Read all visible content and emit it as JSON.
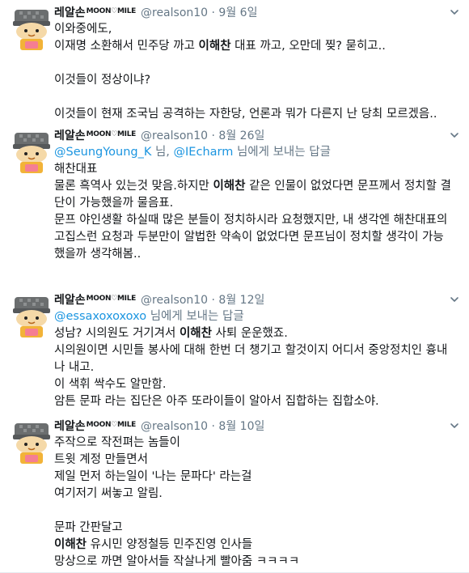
{
  "tweets": [
    {
      "name": "레알손",
      "name_sup": "MOON♡MILE",
      "handle_date": "@realson10 · 9월 6일",
      "reply": null,
      "lines": [
        {
          "parts": [
            "이와중에도,"
          ]
        },
        {
          "parts": [
            "이재명 소환해서 민주당 까고 ",
            "이해찬",
            " 대표 까고, 오만데 찢? 묻히고.."
          ],
          "bold": [
            1
          ]
        },
        {
          "parts": [
            ""
          ]
        },
        {
          "parts": [
            "이것들이 정상이냐?"
          ]
        },
        {
          "parts": [
            ""
          ]
        },
        {
          "parts": [
            "이것들이 현재 조국님 공격하는 자한당, 언론과 뭐가 다른지 난 당최 모르겠음.."
          ]
        }
      ]
    },
    {
      "name": "레알손",
      "name_sup": "MOON♡MILE",
      "handle_date": "@realson10 · 8월 26일",
      "reply": {
        "m1": "@SeungYoung_K",
        "sep": " 님, ",
        "m2": "@IEcharm",
        "suffix": " 님에게 보내는 답글"
      },
      "lines": [
        {
          "parts": [
            "해찬대표"
          ]
        },
        {
          "parts": [
            "물론 흑역사 있는것 맞음.하지만 ",
            "이해찬",
            " 같은 인물이 없었다면 문프께서 정치할 결"
          ],
          "bold": [
            1
          ]
        },
        {
          "parts": [
            "단이 가능했을까 물음표."
          ]
        },
        {
          "parts": [
            "문프 야인생활 하실때 많은 분들이 정치하시라 요청했지만, 내 생각엔 해찬대표의"
          ]
        },
        {
          "parts": [
            "고집스런 요청과 두분만이 알법한 약속이 없었다면 문프님이 정치할 생각이 가능"
          ]
        },
        {
          "parts": [
            "했을까 생각해봄.."
          ]
        }
      ]
    },
    {
      "name": "레알손",
      "name_sup": "MOON♡MILE",
      "handle_date": "@realson10 · 8월 12일",
      "reply": {
        "m1": "@essaxoxoxoxo",
        "sep": "",
        "m2": "",
        "suffix": " 님에게 보내는 답글"
      },
      "lines": [
        {
          "parts": [
            "성남? 시의원도 거기겨서 ",
            "이해찬",
            " 사퇴 운운했죠."
          ],
          "bold": [
            1
          ]
        },
        {
          "parts": [
            "시의원이면 시민들 봉사에 대해 한번 더 챙기고 할것이지 어디서 중앙정치인 흉내"
          ]
        },
        {
          "parts": [
            "나 내고."
          ]
        },
        {
          "parts": [
            "이 색휘 싹수도 알만함."
          ]
        },
        {
          "parts": [
            "암튼 문파 라는 집단은 아주 또라이들이 알아서 집합하는 집합소야."
          ]
        }
      ]
    },
    {
      "name": "레알손",
      "name_sup": "MOON♡MILE",
      "handle_date": "@realson10 · 8월 10일",
      "reply": null,
      "lines": [
        {
          "parts": [
            "주작으로 작전펴는 놈들이"
          ]
        },
        {
          "parts": [
            "트윗 계정 만들면서"
          ]
        },
        {
          "parts": [
            "제일 먼저 하는일이 '나는 문파다' 라는걸"
          ]
        },
        {
          "parts": [
            "여기저기 써놓고 알림."
          ]
        },
        {
          "parts": [
            ""
          ]
        },
        {
          "parts": [
            "문파 간판달고"
          ]
        },
        {
          "parts": [
            "이해찬",
            " 유시민 양정철등 민주진영 인사들"
          ],
          "bold": [
            0
          ]
        },
        {
          "parts": [
            "망상으로 까면 알아서들 작살나게 빨아줌 ㅋㅋㅋㅋ"
          ]
        }
      ]
    }
  ]
}
